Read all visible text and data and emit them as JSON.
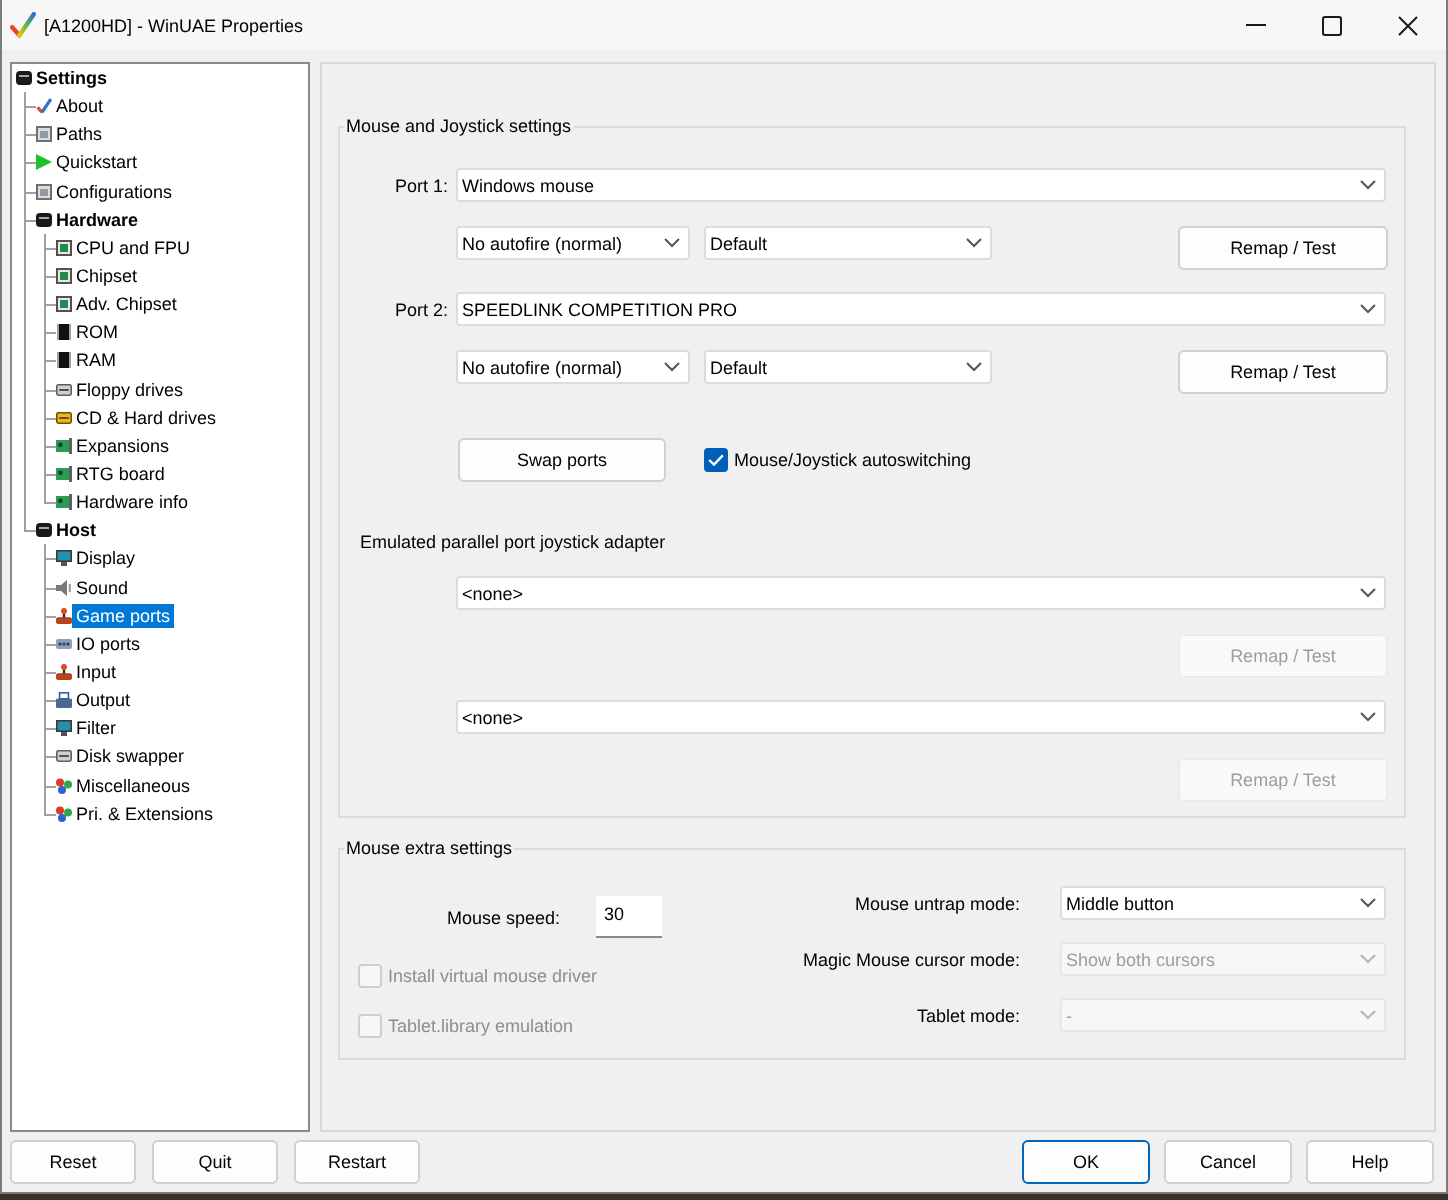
{
  "window": {
    "title": "[A1200HD] - WinUAE Properties"
  },
  "tree": [
    {
      "label": "Settings",
      "selected": false,
      "children": [
        {
          "label": "About",
          "selected": false
        },
        {
          "label": "Paths",
          "selected": false
        },
        {
          "label": "Quickstart",
          "selected": false
        },
        {
          "label": "Configurations",
          "selected": false
        },
        {
          "label": "Hardware",
          "selected": false,
          "children": [
            {
              "label": "CPU and FPU",
              "selected": false
            },
            {
              "label": "Chipset",
              "selected": false
            },
            {
              "label": "Adv. Chipset",
              "selected": false
            },
            {
              "label": "ROM",
              "selected": false
            },
            {
              "label": "RAM",
              "selected": false
            },
            {
              "label": "Floppy drives",
              "selected": false
            },
            {
              "label": "CD & Hard drives",
              "selected": false
            },
            {
              "label": "Expansions",
              "selected": false
            },
            {
              "label": "RTG board",
              "selected": false
            },
            {
              "label": "Hardware info",
              "selected": false
            }
          ]
        },
        {
          "label": "Host",
          "selected": false,
          "children": [
            {
              "label": "Display",
              "selected": false
            },
            {
              "label": "Sound",
              "selected": false
            },
            {
              "label": "Game ports",
              "selected": true
            },
            {
              "label": "IO ports",
              "selected": false
            },
            {
              "label": "Input",
              "selected": false
            },
            {
              "label": "Output",
              "selected": false
            },
            {
              "label": "Filter",
              "selected": false
            },
            {
              "label": "Disk swapper",
              "selected": false
            },
            {
              "label": "Miscellaneous",
              "selected": false
            },
            {
              "label": "Pri. & Extensions",
              "selected": false
            }
          ]
        }
      ]
    }
  ],
  "joystick_settings": {
    "title": "Mouse and Joystick settings",
    "ports": [
      {
        "label": "Port 1:",
        "device": "Windows mouse",
        "autofire": "No autofire (normal)",
        "mode": "Default",
        "remap": {
          "label": "Remap / Test",
          "disabled": false
        }
      },
      {
        "label": "Port 2:",
        "device": "SPEEDLINK COMPETITION PRO",
        "autofire": "No autofire (normal)",
        "mode": "Default",
        "remap": {
          "label": "Remap / Test",
          "disabled": false
        }
      }
    ],
    "swap_button": "Swap ports",
    "autoswitch": {
      "label": "Mouse/Joystick autoswitching",
      "checked": true
    },
    "parallel_adapter": {
      "title": "Emulated parallel port joystick adapter",
      "ports": [
        {
          "device": "<none>",
          "remap": {
            "label": "Remap / Test",
            "disabled": true
          }
        },
        {
          "device": "<none>",
          "remap": {
            "label": "Remap / Test",
            "disabled": true
          }
        }
      ]
    }
  },
  "mouse_extra": {
    "title": "Mouse extra settings",
    "speed": {
      "label": "Mouse speed:",
      "value": "30"
    },
    "options": [
      {
        "label": "Install virtual mouse driver",
        "checked": false,
        "disabled": true
      },
      {
        "label": "Tablet.library emulation",
        "checked": false,
        "disabled": true
      }
    ],
    "modes": [
      {
        "label": "Mouse untrap mode:",
        "value": "Middle button",
        "disabled": false
      },
      {
        "label": "Magic Mouse cursor mode:",
        "value": "Show both cursors",
        "disabled": true
      },
      {
        "label": "Tablet mode:",
        "value": "-",
        "disabled": true
      }
    ]
  },
  "footer": {
    "left": [
      {
        "label": "Reset",
        "default": false
      },
      {
        "label": "Quit",
        "default": false
      },
      {
        "label": "Restart",
        "default": false
      }
    ],
    "right": [
      {
        "label": "OK",
        "default": true
      },
      {
        "label": "Cancel",
        "default": false
      },
      {
        "label": "Help",
        "default": false
      }
    ]
  }
}
